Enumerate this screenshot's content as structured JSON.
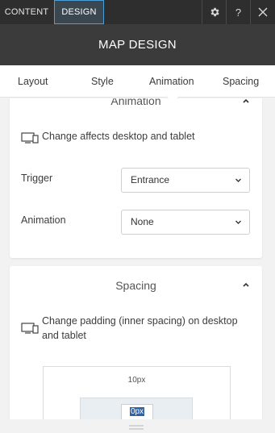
{
  "toolbar": {
    "tabs": [
      {
        "label": "CONTENT",
        "active": false
      },
      {
        "label": "DESIGN",
        "active": true
      }
    ],
    "icons": [
      "gear-icon",
      "help-icon",
      "close-icon"
    ],
    "help_label": "?"
  },
  "header": {
    "title": "MAP DESIGN"
  },
  "subnav": {
    "tabs": [
      {
        "label": "Layout"
      },
      {
        "label": "Style"
      },
      {
        "label": "Animation",
        "active": true
      },
      {
        "label": "Spacing"
      }
    ]
  },
  "animation_section": {
    "title": "Animation",
    "note": "Change affects desktop and tablet",
    "trigger": {
      "label": "Trigger",
      "value": "Entrance"
    },
    "animation": {
      "label": "Animation",
      "value": "None"
    }
  },
  "spacing_section": {
    "title": "Spacing",
    "note": "Change padding (inner spacing) on desktop and tablet",
    "outer_value": "10px",
    "inner_value": "0px"
  },
  "colors": {
    "toolbar_bg": "#2e2e2e",
    "header_bg": "#3b3b3b",
    "active_tab_border": "#4b9fd6",
    "selection": "#2f62a8"
  }
}
